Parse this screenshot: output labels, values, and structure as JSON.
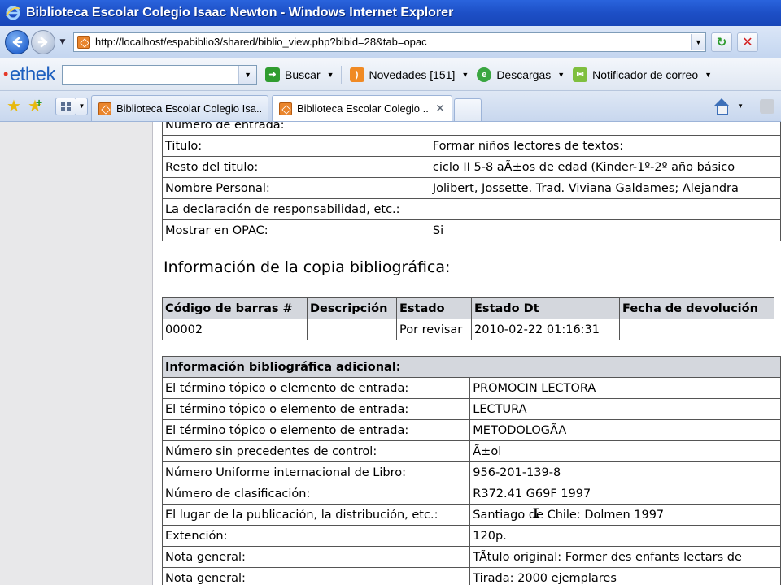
{
  "window": {
    "title": "Biblioteca Escolar Colegio Isaac Newton - Windows Internet Explorer"
  },
  "address": {
    "url": "http://localhost/espabiblio3/shared/biblio_view.php?bibid=28&tab=opac"
  },
  "ethek_toolbar": {
    "logo": "ethek",
    "search_value": "",
    "buscar_label": "Buscar",
    "novedades_label": "Novedades [151]",
    "descargas_label": "Descargas",
    "notificador_label": "Notificador de correo"
  },
  "tabs": [
    {
      "label": "Biblioteca Escolar Colegio Isa...",
      "active": false
    },
    {
      "label": "Biblioteca Escolar Colegio ...",
      "active": true
    }
  ],
  "record_fields": [
    {
      "label": "Número de entrada:",
      "value": ""
    },
    {
      "label": "Titulo:",
      "value": "Formar niños lectores de textos:"
    },
    {
      "label": "Resto del titulo:",
      "value": "ciclo II 5-8 aÃ±os de edad (Kinder-1º-2º año básico"
    },
    {
      "label": "Nombre Personal:",
      "value": "Jolibert, Jossette. Trad. Viviana Galdames; Alejandra"
    },
    {
      "label": "La declaración de responsabilidad, etc.:",
      "value": ""
    },
    {
      "label": "Mostrar en OPAC:",
      "value": "Si"
    }
  ],
  "copy_section": {
    "title": "Información de la copia bibliográfica:",
    "headers": [
      "Código de barras #",
      "Descripción",
      "Estado",
      "Estado Dt",
      "Fecha de devolución"
    ],
    "rows": [
      [
        "00002",
        "",
        "Por revisar",
        "2010-02-22 01:16:31",
        ""
      ]
    ]
  },
  "additional_info": {
    "header": "Información bibliográfica adicional:",
    "rows": [
      {
        "label": "El término tópico o elemento de entrada:",
        "value": "PROMOCIN LECTORA"
      },
      {
        "label": "El término tópico o elemento de entrada:",
        "value": "LECTURA"
      },
      {
        "label": "El término tópico o elemento de entrada:",
        "value": "METODOLOGÃA"
      },
      {
        "label": "Número sin precedentes de control:",
        "value": "Ã±ol"
      },
      {
        "label": "Número Uniforme internacional de Libro:",
        "value": "956-201-139-8"
      },
      {
        "label": "Número de clasificación:",
        "value": "R372.41 G69F 1997"
      },
      {
        "label": "El lugar de la publicación, la distribución, etc.:",
        "value": "Santiago de Chile: Dolmen 1997"
      },
      {
        "label": "Extención:",
        "value": "120p."
      },
      {
        "label": "Nota general:",
        "value": "TÃtulo original: Former des enfants lectars de"
      },
      {
        "label": "Nota general:",
        "value": "Tirada: 2000 ejemplares"
      }
    ]
  }
}
